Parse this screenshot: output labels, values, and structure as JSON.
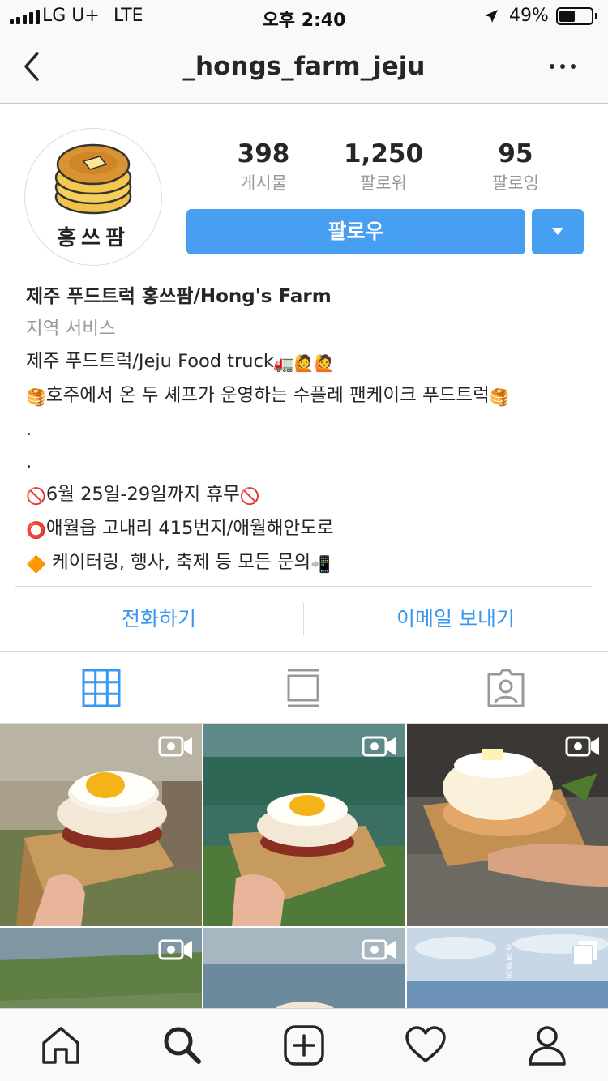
{
  "status_bar": {
    "carrier": "LG U+",
    "network": "LTE",
    "time": "오후 2:40",
    "battery_percent": "49%",
    "battery_level": 0.49
  },
  "nav": {
    "title": "_hongs_farm_jeju",
    "back_icon": "chevron-left-icon",
    "more_icon": "ellipsis-icon"
  },
  "profile": {
    "avatar_text": "홍쓰팜",
    "stats": [
      {
        "value": "398",
        "label": "게시물"
      },
      {
        "value": "1,250",
        "label": "팔로워"
      },
      {
        "value": "95",
        "label": "팔로잉"
      }
    ],
    "follow_label": "팔로우",
    "accent_color": "#3897f0"
  },
  "bio": {
    "name": "제주 푸드트럭 홍쓰팜/Hong's Farm",
    "category": "지역 서비스",
    "line1": "제주 푸드트럭/Jeju Food truck",
    "line1_emoji": "🚛🙋🙋",
    "line2_emoji_start": "🥞",
    "line2": "호주에서 온 두 셰프가 운영하는 수플레 팬케이크 푸드트럭",
    "line2_emoji_end": "🥞",
    "dot1": ".",
    "dot2": ".",
    "line3_emoji": "🚫",
    "line3": "6월 25일-29일까지 휴무",
    "line4_emoji": "⭕",
    "line4": "애월읍 고내리 415번지/애월해안도로",
    "line5_emoji": "🔶",
    "line5": " 케이터링, 행사, 축제 등 모든 문의",
    "line5_emoji_end": "📲"
  },
  "contact": {
    "call_label": "전화하기",
    "email_label": "이메일 보내기"
  },
  "tabs": [
    "grid-icon",
    "feed-icon",
    "tagged-icon"
  ],
  "grid": [
    {
      "type": "video"
    },
    {
      "type": "video"
    },
    {
      "type": "video"
    },
    {
      "type": "video"
    },
    {
      "type": "video"
    },
    {
      "type": "multi",
      "caption": "우실생실"
    }
  ],
  "bottom_nav": [
    "home-icon",
    "search-icon",
    "add-icon",
    "heart-icon",
    "profile-icon"
  ]
}
